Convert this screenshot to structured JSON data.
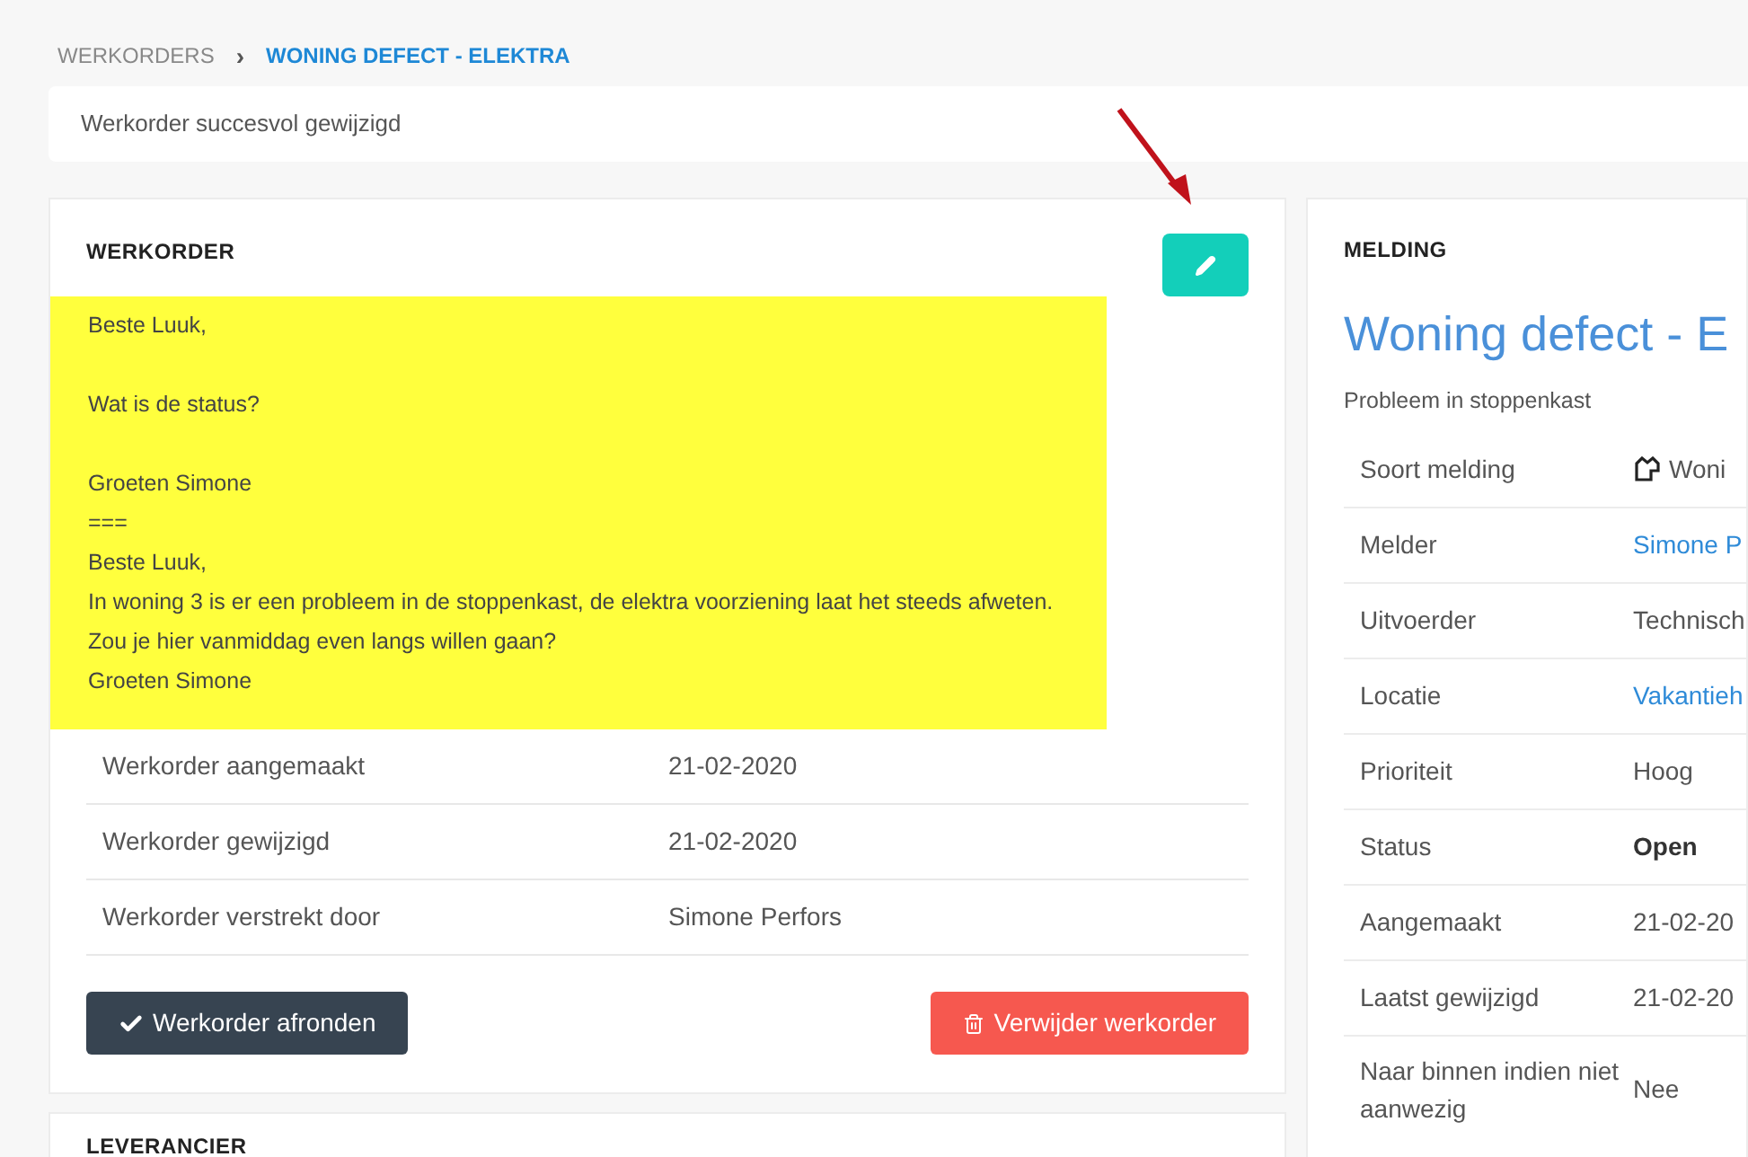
{
  "breadcrumb": [
    {
      "label": "WERKORDERS",
      "selected": false
    },
    {
      "label": "WONING DEFECT - ELEKTRA",
      "selected": true
    }
  ],
  "breadcrumb_separator": "›",
  "alert": {
    "text": "Werkorder succesvol gewijzigd"
  },
  "werkorder": {
    "title": "WERKORDER",
    "message": [
      [
        "Beste Luuk,"
      ],
      [
        "Wat is de status?"
      ],
      [
        "Groeten Simone",
        "===",
        "Beste Luuk,",
        "In woning 3 is er een probleem in de stoppenkast, de elektra voorziening laat het steeds afweten.",
        "Zou je hier vanmiddag even langs willen gaan?",
        "Groeten Simone"
      ]
    ],
    "rows": [
      {
        "label": "Werkorder aangemaakt",
        "value": "21-02-2020"
      },
      {
        "label": "Werkorder gewijzigd",
        "value": "21-02-2020"
      },
      {
        "label": "Werkorder verstrekt door",
        "value": "Simone Perfors"
      }
    ],
    "buttons": [
      {
        "label": "Werkorder afronden",
        "kind": "complete"
      },
      {
        "label": "Verwijder werkorder",
        "kind": "delete"
      }
    ]
  },
  "melding": {
    "title": "MELDING",
    "heading": "Woning defect - E",
    "subtitle": "Probleem in stoppenkast",
    "rows": [
      {
        "label": "Soort melding",
        "value": "Woni",
        "kind": "icon"
      },
      {
        "label": "Melder",
        "value": "Simone P",
        "kind": "link"
      },
      {
        "label": "Uitvoerder",
        "value": "Technisch",
        "kind": "text"
      },
      {
        "label": "Locatie",
        "value": "Vakantieh",
        "kind": "link"
      },
      {
        "label": "Prioriteit",
        "value": "Hoog",
        "kind": "text"
      },
      {
        "label": "Status",
        "value": "Open",
        "kind": "bold"
      },
      {
        "label": "Aangemaakt",
        "value": "21-02-20",
        "kind": "text"
      },
      {
        "label": "Laatst gewijzigd",
        "value": "21-02-20",
        "kind": "text"
      },
      {
        "label": "Naar binnen indien niet aanwezig",
        "value": "Nee",
        "kind": "text"
      }
    ]
  },
  "leverancier": {
    "title": "LEVERANCIER"
  }
}
